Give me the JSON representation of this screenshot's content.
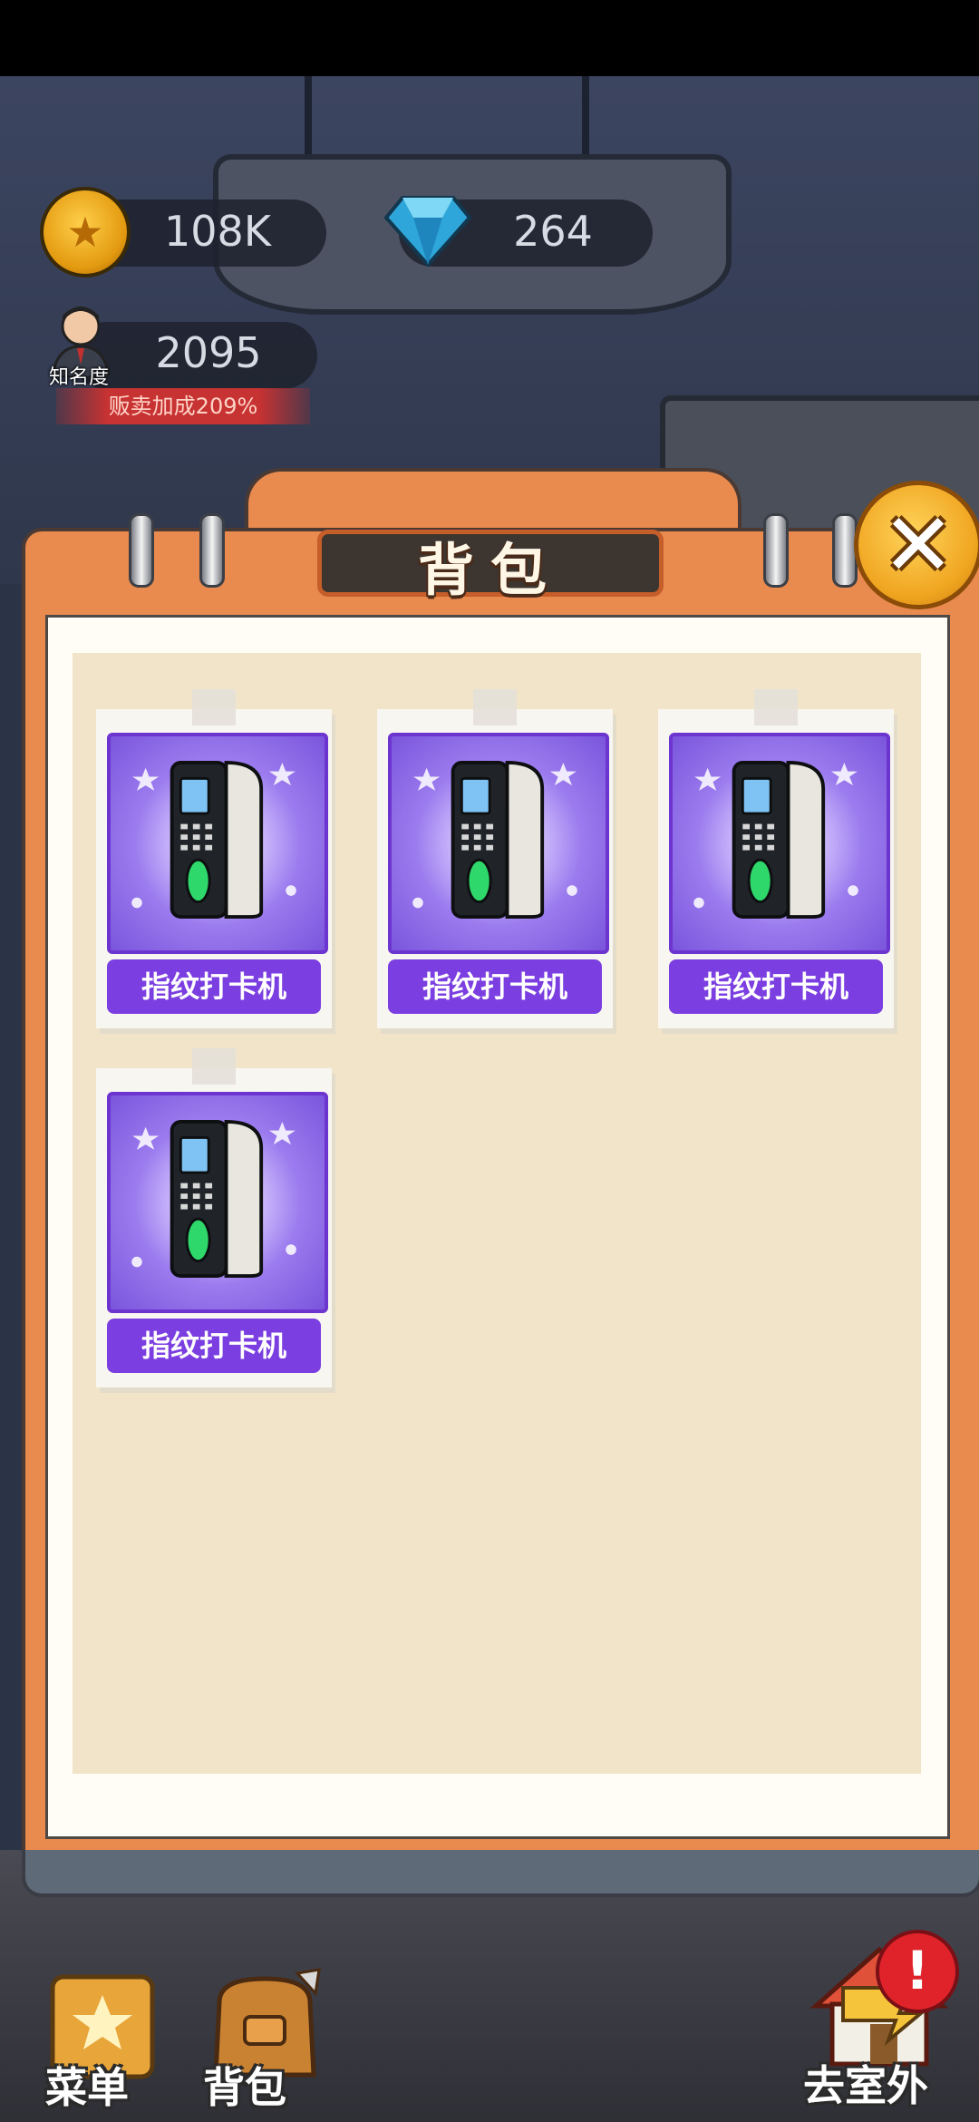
{
  "hud": {
    "coins": "108K",
    "gems": "264",
    "fame_value": "2095",
    "fame_label": "知名度",
    "fame_bonus": "贩卖加成209%"
  },
  "panel": {
    "title": "背包",
    "close_icon": "close-x"
  },
  "items": [
    {
      "label": "指纹打卡机",
      "icon": "fingerprint-clock-icon"
    },
    {
      "label": "指纹打卡机",
      "icon": "fingerprint-clock-icon"
    },
    {
      "label": "指纹打卡机",
      "icon": "fingerprint-clock-icon"
    },
    {
      "label": "指纹打卡机",
      "icon": "fingerprint-clock-icon"
    }
  ],
  "bottom_nav": {
    "menu_label": "菜单",
    "bag_label": "背包",
    "outdoor_label": "去室外",
    "alert_symbol": "!"
  },
  "colors": {
    "panel_orange": "#e98a4f",
    "item_purple": "#7b3ee0",
    "paper_cream": "#f2e4c8"
  }
}
